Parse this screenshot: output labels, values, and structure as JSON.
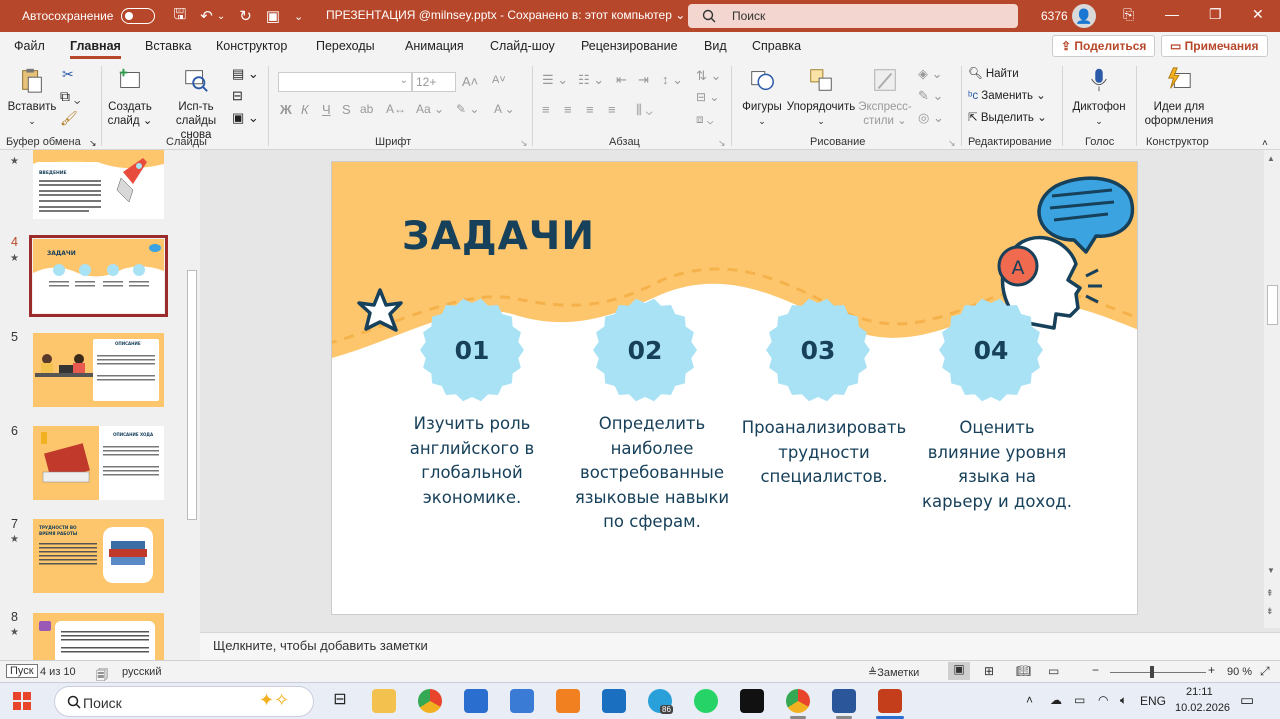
{
  "titlebar": {
    "autosave_label": "Автосохранение",
    "document_title": "ПРЕЗЕНТАЦИЯ @milnsey.pptx  -  Сохранено в: этот компьютер  ⌄",
    "search_placeholder": "Поиск",
    "user_number": "6376"
  },
  "menu": {
    "tabs": [
      "Файл",
      "Главная",
      "Вставка",
      "Конструктор",
      "Переходы",
      "Анимация",
      "Слайд-шоу",
      "Рецензирование",
      "Вид",
      "Справка"
    ],
    "share": "Поделиться",
    "comments": "Примечания"
  },
  "ribbon": {
    "paste": "Вставить",
    "new_slide_1": "Создать",
    "new_slide_2": "слайд ⌄",
    "reuse_1": "Исп-ть",
    "reuse_2": "слайды снова",
    "font_size": "12+",
    "bold": "Ж",
    "italic": "К",
    "underline": "Ч",
    "strike": "S",
    "shapes": "Фигуры",
    "arrange": "Упорядочить",
    "quick_styles_1": "Экспресс-",
    "quick_styles_2": "стили ⌄",
    "find": "Найти",
    "replace": "Заменить",
    "select": "Выделить",
    "dictate": "Диктофон",
    "designer_1": "Идеи для",
    "designer_2": "оформления",
    "groups": {
      "clipboard": "Буфер обмена",
      "slides": "Слайды",
      "font": "Шрифт",
      "paragraph": "Абзац",
      "drawing": "Рисование",
      "editing": "Редактирование",
      "voice": "Голос",
      "designer": "Конструктор"
    }
  },
  "thumbnails": [
    {
      "num": "",
      "title": "ВВЕДЕНИЕ"
    },
    {
      "num": "4",
      "title": "ЗАДАЧИ"
    },
    {
      "num": "5",
      "title": "ОПИСАНИЕ ХОДА РАБОТЫ"
    },
    {
      "num": "6",
      "title": "ОПИСАНИЕ ХОДА РАБОТЫ"
    },
    {
      "num": "7",
      "title": "ТРУДНОСТИ ВО ВРЕМЯ РАБОТЫ"
    },
    {
      "num": "8",
      "title": ""
    }
  ],
  "slide": {
    "title": "ЗАДАЧИ",
    "bubble_letter": "A",
    "tasks": [
      {
        "num": "01",
        "text": "Изучить роль английского в глобальной экономике."
      },
      {
        "num": "02",
        "text": "Определить наиболее востребованные языковые навыки по сферам."
      },
      {
        "num": "03",
        "text": "Проанализировать трудности специалистов."
      },
      {
        "num": "04",
        "text": "Оценить влияние уровня языка на карьеру и доход."
      }
    ]
  },
  "notes_placeholder": "Щелкните, чтобы добавить заметки",
  "status": {
    "tooltip": "Пуск",
    "slide_counter": "4 из 10",
    "language": "русский",
    "notes_btn": "Заметки",
    "zoom": "90 %"
  },
  "taskbar": {
    "search": "Поиск",
    "lang": "ENG",
    "time": "21:11",
    "date": "10.02.2026",
    "telegram_badge": "86"
  },
  "colors": {
    "accent": "#b7472a",
    "slide_yellow": "#fdc66d",
    "badge_blue": "#a9e2f5",
    "text_navy": "#17405a"
  }
}
